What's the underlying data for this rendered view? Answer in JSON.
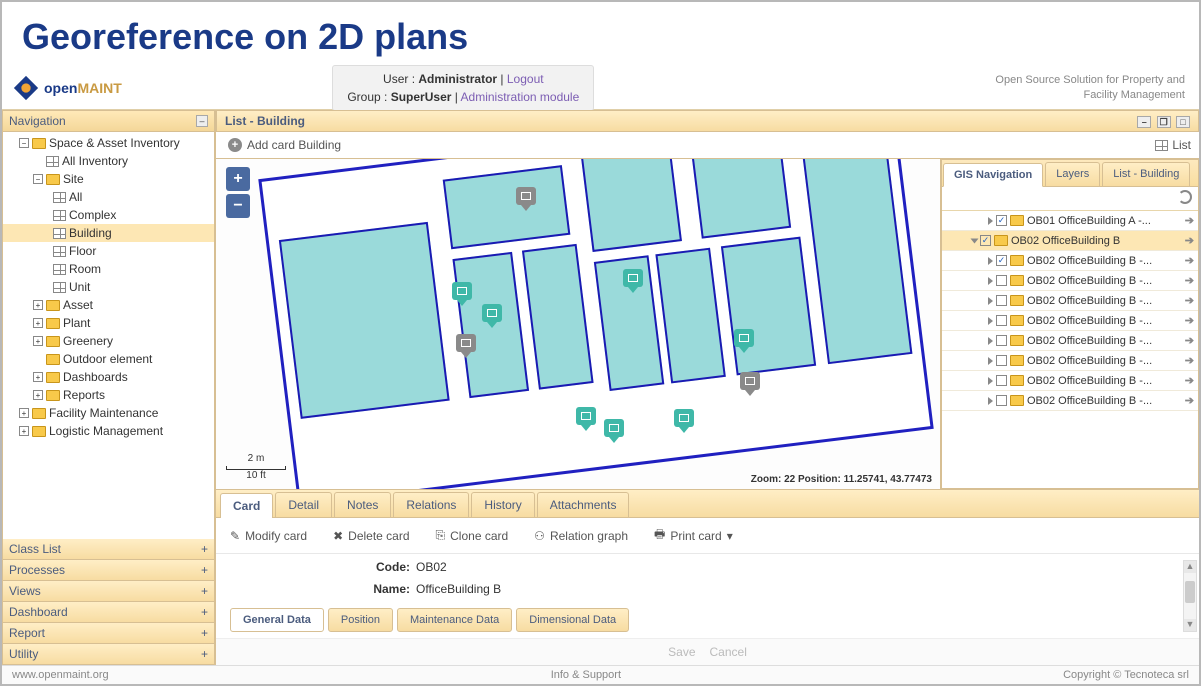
{
  "page_title": "Georeference on 2D plans",
  "brand": {
    "name_a": "open",
    "name_b": "MAINT"
  },
  "user_bar": {
    "user_label": "User :",
    "user_value": "Administrator",
    "logout": "Logout",
    "group_label": "Group :",
    "group_value": "SuperUser",
    "admin_link": "Administration module"
  },
  "tagline": {
    "l1": "Open Source Solution for Property and",
    "l2": "Facility Management"
  },
  "nav": {
    "title": "Navigation",
    "tree": {
      "space_asset": "Space & Asset Inventory",
      "all_inventory": "All Inventory",
      "site": "Site",
      "all": "All",
      "complex": "Complex",
      "building": "Building",
      "floor": "Floor",
      "room": "Room",
      "unit": "Unit",
      "asset": "Asset",
      "plant": "Plant",
      "greenery": "Greenery",
      "outdoor": "Outdoor element",
      "dashboards": "Dashboards",
      "reports": "Reports",
      "facility_maint": "Facility Maintenance",
      "logistic_mgmt": "Logistic Management"
    },
    "accordions": {
      "class_list": "Class List",
      "processes": "Processes",
      "views": "Views",
      "dashboard": "Dashboard",
      "report": "Report",
      "utility": "Utility"
    }
  },
  "list_panel": {
    "title": "List - Building",
    "add_card": "Add card Building",
    "list_label": "List"
  },
  "map": {
    "zoom_label": "Zoom:",
    "zoom_value": "22",
    "pos_label": "Position:",
    "pos_value": "11.25741, 43.77473",
    "scale_m": "2 m",
    "scale_ft": "10 ft"
  },
  "gis": {
    "tabs": {
      "nav": "GIS Navigation",
      "layers": "Layers",
      "list": "List - Building"
    },
    "rows": [
      {
        "label": "OB01 OfficeBuilding A -...",
        "level": 1,
        "checked": true
      },
      {
        "label": "OB02 OfficeBuilding B",
        "level": 0,
        "checked": true,
        "open": true,
        "sel": true
      },
      {
        "label": "OB02 OfficeBuilding B -...",
        "level": 1,
        "checked": true
      },
      {
        "label": "OB02 OfficeBuilding B -...",
        "level": 1,
        "checked": false
      },
      {
        "label": "OB02 OfficeBuilding B -...",
        "level": 1,
        "checked": false
      },
      {
        "label": "OB02 OfficeBuilding B -...",
        "level": 1,
        "checked": false
      },
      {
        "label": "OB02 OfficeBuilding B -...",
        "level": 1,
        "checked": false
      },
      {
        "label": "OB02 OfficeBuilding B -...",
        "level": 1,
        "checked": false
      },
      {
        "label": "OB02 OfficeBuilding B -...",
        "level": 1,
        "checked": false
      },
      {
        "label": "OB02 OfficeBuilding B -...",
        "level": 1,
        "checked": false
      }
    ]
  },
  "detail": {
    "tabs": {
      "card": "Card",
      "detail": "Detail",
      "notes": "Notes",
      "relations": "Relations",
      "history": "History",
      "attachments": "Attachments"
    },
    "toolbar": {
      "modify": "Modify card",
      "delete": "Delete card",
      "clone": "Clone card",
      "relation_graph": "Relation graph",
      "print": "Print card"
    },
    "form": {
      "code_label": "Code:",
      "code_value": "OB02",
      "name_label": "Name:",
      "name_value": "OfficeBuilding B"
    },
    "subtabs": {
      "general": "General Data",
      "position": "Position",
      "maintenance": "Maintenance Data",
      "dimensional": "Dimensional Data"
    },
    "save": "Save",
    "cancel": "Cancel"
  },
  "footer": {
    "left": "www.openmaint.org",
    "center": "Info & Support",
    "right": "Copyright © Tecnoteca srl"
  }
}
